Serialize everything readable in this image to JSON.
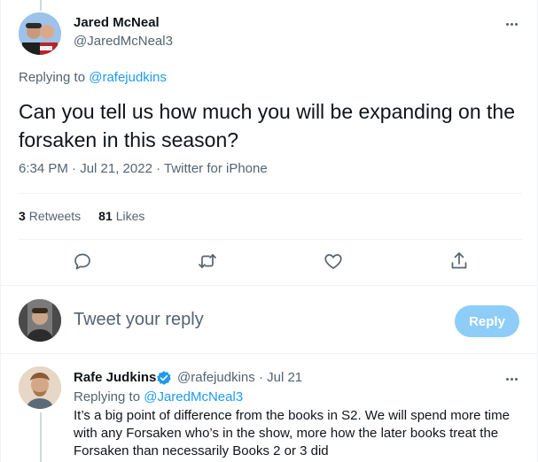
{
  "main_tweet": {
    "author_name": "Jared McNeal",
    "author_handle": "@JaredMcNeal3",
    "replying_prefix": "Replying to ",
    "replying_to": "@rafejudkins",
    "text": "Can you tell us how much you will be expanding on the forsaken in this season?",
    "meta": "6:34 PM · Jul 21, 2022 · Twitter for iPhone",
    "retweets_count": "3",
    "retweets_label": "Retweets",
    "likes_count": "81",
    "likes_label": "Likes",
    "actions": [
      "reply-icon",
      "retweet-icon",
      "like-icon",
      "share-icon"
    ]
  },
  "compose": {
    "placeholder": "Tweet your reply",
    "button_label": "Reply"
  },
  "reply_tweet": {
    "author_name": "Rafe Judkins",
    "author_handle": "@rafejudkins",
    "separator": "·",
    "date": "Jul 21",
    "replying_prefix": "Replying to ",
    "replying_to": "@JaredMcNeal3",
    "text": "It’s a big point of difference from the books in S2.  We will spend more time with any Forsaken who’s in the show, more how the later books treat the Forsaken than necessarily Books 2 or 3 did"
  },
  "colors": {
    "accent": "#1d9bf0",
    "reply_button": "#8ecdf8",
    "secondary_text": "#536471",
    "primary_text": "#0f1419"
  }
}
